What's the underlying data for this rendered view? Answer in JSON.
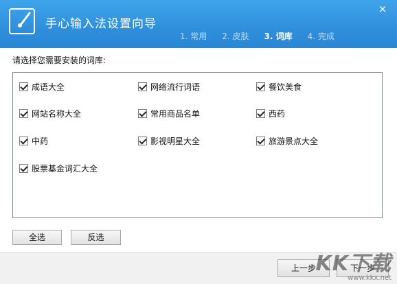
{
  "header": {
    "title": "手心输入法设置向导",
    "close_glyph": "×",
    "steps": [
      {
        "label": "1. 常用",
        "active": false
      },
      {
        "label": "2. 皮肤",
        "active": false
      },
      {
        "label": "3. 词库",
        "active": true
      },
      {
        "label": "4. 完成",
        "active": false
      }
    ]
  },
  "main": {
    "prompt": "请选择您需要安装的词库:",
    "dictionaries": [
      {
        "label": "成语大全",
        "checked": true
      },
      {
        "label": "网络流行词语",
        "checked": true
      },
      {
        "label": "餐饮美食",
        "checked": true
      },
      {
        "label": "网站名称大全",
        "checked": true
      },
      {
        "label": "常用商品名单",
        "checked": true
      },
      {
        "label": "西药",
        "checked": true
      },
      {
        "label": "中药",
        "checked": true
      },
      {
        "label": "影视明星大全",
        "checked": true
      },
      {
        "label": "旅游景点大全",
        "checked": true
      },
      {
        "label": "股票基金词汇大全",
        "checked": true
      }
    ],
    "select_all_label": "全选",
    "invert_label": "反选"
  },
  "footer": {
    "prev_label": "上一步",
    "next_label": "下一步"
  },
  "watermark": {
    "big": "KK下载",
    "small": "www.kkx.net"
  },
  "colors": {
    "header_blue": "#2f8fdc",
    "border": "#7f8a96"
  }
}
